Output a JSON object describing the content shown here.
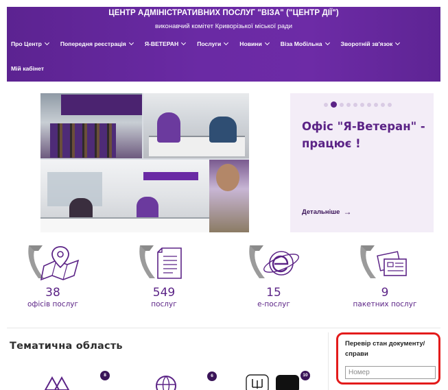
{
  "header": {
    "title": "ЦЕНТР АДМІНІСТРАТИВНИХ ПОСЛУГ \"ВІЗА\" (\"ЦЕНТР ДІЇ\")",
    "subtitle": "виконавчий комітет Криворізької міської ради",
    "nav": [
      {
        "label": "Про Центр"
      },
      {
        "label": "Попередня реєстрація"
      },
      {
        "label": "Я-ВЕТЕРАН"
      },
      {
        "label": "Послуги"
      },
      {
        "label": "Новини"
      },
      {
        "label": "Віза Мобільна"
      },
      {
        "label": "Зворотній зв'язок"
      }
    ],
    "cabinet": "Мій кабінет",
    "color": "#6a2aa4"
  },
  "hero": {
    "slide_title": "Офіс \"Я-Ветеран\" - працює !",
    "more_label": "Детальніше",
    "slide_count": 10,
    "active_slide": 2
  },
  "stats": [
    {
      "value": "38",
      "label": "офісів послуг",
      "icon": "map-pin-icon"
    },
    {
      "value": "549",
      "label": "послуг",
      "icon": "document-icon"
    },
    {
      "value": "15",
      "label": "е-послуг",
      "icon": "e-globe-icon"
    },
    {
      "value": "9",
      "label": "пакетних послуг",
      "icon": "package-icon"
    }
  ],
  "topics": {
    "title": "Тематична область",
    "items": [
      {
        "badge": "8",
        "icon": "topic-icon"
      },
      {
        "badge": "6",
        "icon": "globe-icon"
      },
      {
        "badge": "10",
        "icon": "trident-icon"
      }
    ]
  },
  "status_check": {
    "label": "Перевір стан документу/справи",
    "placeholder": "Номер",
    "highlight_color": "#e31b1b"
  }
}
